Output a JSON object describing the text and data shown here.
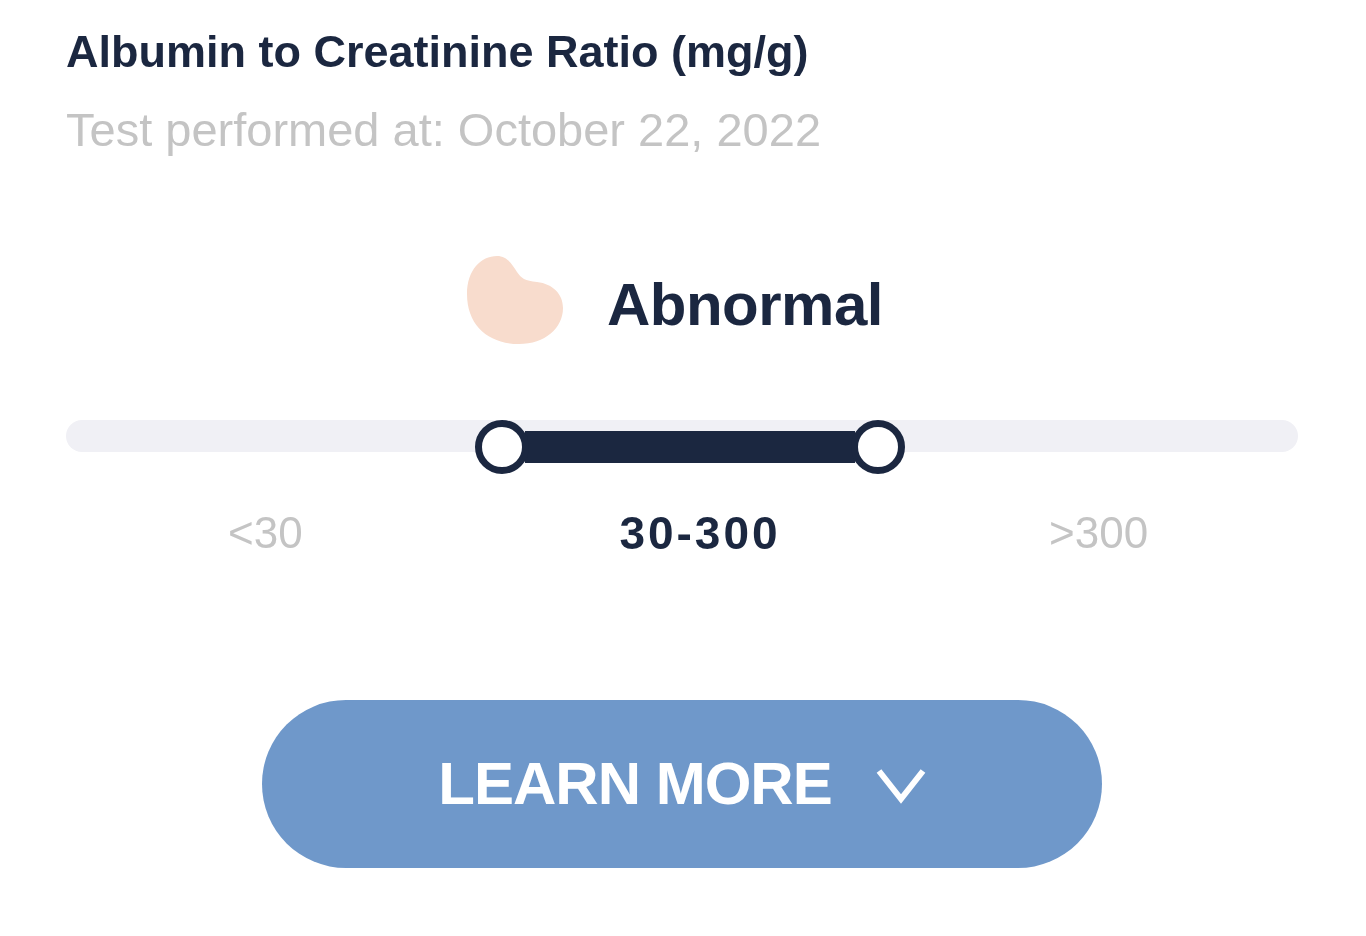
{
  "title": "Albumin to Creatinine Ratio (mg/g)",
  "subtitle": "Test performed at: October 22, 2022",
  "status": {
    "label": "Abnormal"
  },
  "ranges": [
    {
      "label": "<30",
      "selected": false
    },
    {
      "label": "30-300",
      "selected": true
    },
    {
      "label": ">300",
      "selected": false
    }
  ],
  "button": {
    "label": "LEARN MORE",
    "expanded": false
  }
}
